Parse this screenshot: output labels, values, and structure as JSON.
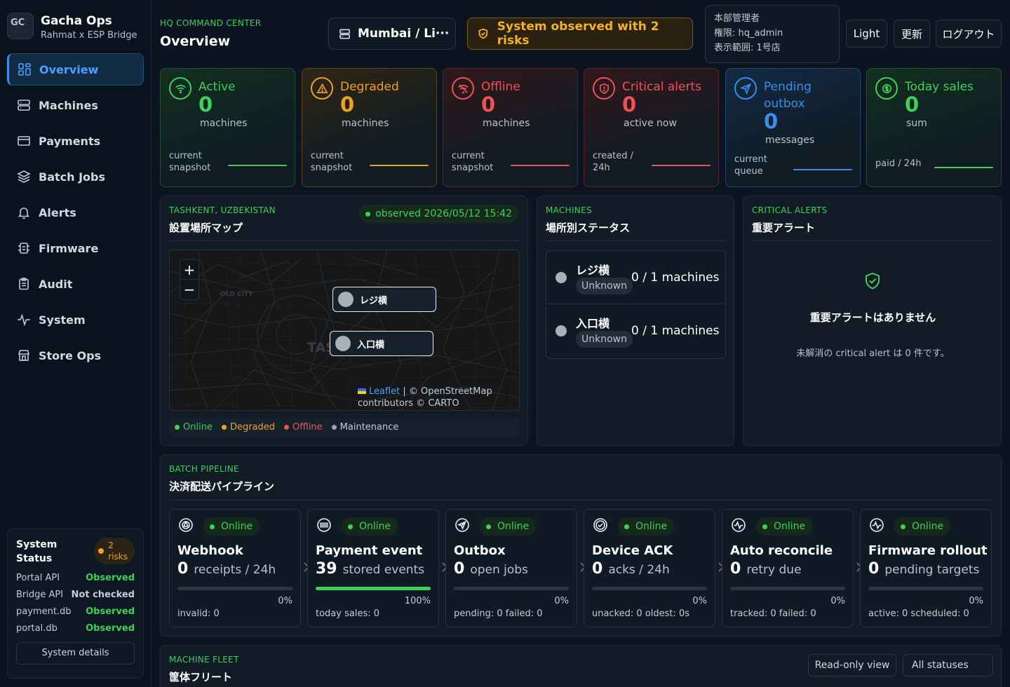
{
  "brand": {
    "logo": "GC",
    "title": "Gacha Ops",
    "subtitle": "Rahmat x ESP Bridge"
  },
  "nav": [
    {
      "label": "Overview",
      "icon": "grid-icon",
      "active": true
    },
    {
      "label": "Machines",
      "icon": "server-icon"
    },
    {
      "label": "Payments",
      "icon": "card-icon"
    },
    {
      "label": "Batch Jobs",
      "icon": "layers-icon"
    },
    {
      "label": "Alerts",
      "icon": "bell-icon"
    },
    {
      "label": "Firmware",
      "icon": "chip-icon"
    },
    {
      "label": "Audit",
      "icon": "clipboard-icon"
    },
    {
      "label": "System",
      "icon": "pulse-icon"
    },
    {
      "label": "Store Ops",
      "icon": "store-icon"
    }
  ],
  "system_status": {
    "title": "System Status",
    "risk_count": "2",
    "risk_label": "risks",
    "rows": [
      {
        "name": "Portal API",
        "status": "Observed"
      },
      {
        "name": "Bridge API",
        "status": "Not checked"
      },
      {
        "name": "payment.db",
        "status": "Observed"
      },
      {
        "name": "portal.db",
        "status": "Observed"
      }
    ],
    "details_button": "System details"
  },
  "header": {
    "eyebrow": "HQ COMMAND CENTER",
    "title": "Overview",
    "location": "Mumbai / Li···",
    "risk_banner": "System observed with 2 risks",
    "user": {
      "role": "本部管理者",
      "permission": "権限: hq_admin",
      "scope": "表示範囲: 1号店"
    },
    "theme_button": "Light",
    "refresh_button": "更新",
    "logout_button": "ログアウト"
  },
  "kpis": [
    {
      "label": "Active",
      "value": "0",
      "unit": "machines",
      "footnote": "current snapshot",
      "color": "#3fcf5a",
      "icon": "wifi-icon"
    },
    {
      "label": "Degraded",
      "value": "0",
      "unit": "machines",
      "footnote": "current snapshot",
      "color": "#f0a020",
      "icon": "warning-icon"
    },
    {
      "label": "Offline",
      "value": "0",
      "unit": "machines",
      "footnote": "current snapshot",
      "color": "#f05252",
      "icon": "wifi-off-icon"
    },
    {
      "label": "Critical alerts",
      "value": "0",
      "unit": "active now",
      "footnote": "created / 24h",
      "color": "#f05252",
      "icon": "shield-alert-icon"
    },
    {
      "label": "Pending outbox",
      "value": "0",
      "unit": "messages",
      "footnote": "current queue",
      "color": "#3b8ee8",
      "icon": "send-icon"
    },
    {
      "label": "Today sales",
      "value": "0",
      "unit": "sum",
      "footnote": "paid / 24h",
      "color": "#3fcf5a",
      "icon": "dollar-icon"
    }
  ],
  "map_panel": {
    "eyebrow": "TASHKENT, UZBEKISTAN",
    "title": "設置場所マップ",
    "observed": "observed 2026/05/12 15:42",
    "zoom_in": "+",
    "zoom_out": "−",
    "labels": {
      "district": "OLD CITY",
      "city": "TAS"
    },
    "markers": [
      "レジ横",
      "入口横"
    ],
    "attribution_link": "Leaflet",
    "attribution_text": "| © OpenStreetMap contributors © CARTO",
    "legend": [
      {
        "label": "Online",
        "color": "#3fcf5a"
      },
      {
        "label": "Degraded",
        "color": "#f0a020"
      },
      {
        "label": "Offline",
        "color": "#f05252"
      },
      {
        "label": "Maintenance",
        "color": "#9aa4ae"
      }
    ]
  },
  "machines_panel": {
    "eyebrow": "MACHINES",
    "title": "場所別ステータス",
    "locations": [
      {
        "name": "レジ横",
        "status": "Unknown",
        "count": "0 / 1 machines"
      },
      {
        "name": "入口横",
        "status": "Unknown",
        "count": "0 / 1 machines"
      }
    ]
  },
  "alerts_panel": {
    "eyebrow": "CRITICAL ALERTS",
    "title": "重要アラート",
    "empty_title": "重要アラートはありません",
    "empty_text": "未解消の critical alert は 0 件です。"
  },
  "pipeline": {
    "eyebrow": "BATCH PIPELINE",
    "title": "決済配送パイプライン",
    "stages": [
      {
        "name": "Webhook",
        "status": "Online",
        "value": "0",
        "metric": "receipts / 24h",
        "progress": 0,
        "pct": "0%",
        "foot": "invalid: 0",
        "icon": "webhook-icon"
      },
      {
        "name": "Payment event",
        "status": "Online",
        "value": "39",
        "metric": "stored events",
        "progress": 1,
        "pct": "100%",
        "foot": "today sales: 0",
        "icon": "database-icon"
      },
      {
        "name": "Outbox",
        "status": "Online",
        "value": "0",
        "metric": "open jobs",
        "progress": 0,
        "pct": "0%",
        "foot": "pending: 0   failed: 0",
        "icon": "send-icon"
      },
      {
        "name": "Device ACK",
        "status": "Online",
        "value": "0",
        "metric": "acks / 24h",
        "progress": 0,
        "pct": "0%",
        "foot": "unacked: 0   oldest: 0s",
        "icon": "check-circle-icon"
      },
      {
        "name": "Auto reconcile",
        "status": "Online",
        "value": "0",
        "metric": "retry due",
        "progress": 0,
        "pct": "0%",
        "foot": "tracked: 0   failed: 0",
        "icon": "activity-icon"
      },
      {
        "name": "Firmware rollout",
        "status": "Online",
        "value": "0",
        "metric": "pending targets",
        "progress": 0,
        "pct": "0%",
        "foot": "active: 0   scheduled: 0",
        "icon": "activity-icon"
      }
    ]
  },
  "fleet": {
    "eyebrow": "MACHINE FLEET",
    "title": "筐体フリート",
    "readonly_button": "Read-only view",
    "filter": "All statuses"
  }
}
